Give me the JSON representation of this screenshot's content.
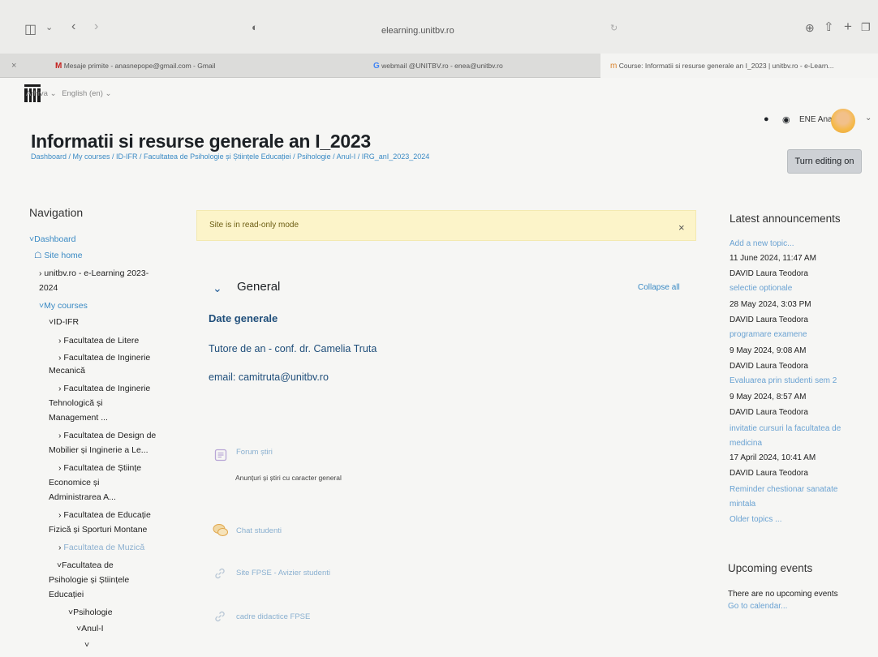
{
  "browser": {
    "address": "elearning.unitbv.ro",
    "tabs": [
      {
        "label": "Mesaje primite - anasnepope@gmail.com - Gmail"
      },
      {
        "label": "webmail @UNITBV.ro - enea@unitbv.ro"
      },
      {
        "label": "Course: Informatii si resurse generale an I_2023 | unitbv.ro - e-Learn..."
      }
    ]
  },
  "topnav": {
    "arhiva": "Arhiva",
    "language": "English (en)",
    "user": "ENE Ana"
  },
  "page": {
    "title": "Informatii si resurse generale an I_2023",
    "breadcrumb": "Dashboard / My courses / ID-IFR / Facultatea de Psihologie și Științele Educației / Psihologie / Anul-I / IRG_anI_2023_2024",
    "turn_editing": "Turn editing on"
  },
  "navigation": {
    "title": "Navigation",
    "items": [
      {
        "label": "Dashboard"
      },
      {
        "label": "Site home"
      },
      {
        "label": "unitbv.ro - e-Learning 2023-"
      },
      {
        "label": "2024"
      },
      {
        "label": "My courses"
      },
      {
        "label": "ID-IFR"
      },
      {
        "label": "Facultatea de Litere"
      },
      {
        "label": "Facultatea de Inginerie"
      },
      {
        "label": "Mecanică"
      },
      {
        "label": "Facultatea de Inginerie"
      },
      {
        "label": "Tehnologică și"
      },
      {
        "label": "Management ..."
      },
      {
        "label": "Facultatea de Design de"
      },
      {
        "label": "Mobilier și Inginerie a Le..."
      },
      {
        "label": "Facultatea de Științe"
      },
      {
        "label": "Economice și"
      },
      {
        "label": "Administrarea A..."
      },
      {
        "label": "Facultatea de Educație"
      },
      {
        "label": "Fizică și Sporturi Montane"
      },
      {
        "label": "Facultatea de Muzică"
      },
      {
        "label": "Facultatea de"
      },
      {
        "label": "Psihologie și Științele"
      },
      {
        "label": "Educației"
      },
      {
        "label": "Psihologie"
      },
      {
        "label": "Anul-I"
      }
    ]
  },
  "main": {
    "alert": "Site is in read-only mode",
    "section_title": "General",
    "collapse_all": "Collapse all",
    "heading": "Date generale",
    "tutor": "Tutore de an - conf. dr. Camelia Truta",
    "email": "email: camitruta@unitbv.ro",
    "activities": [
      {
        "name": "Forum știri",
        "icon": "forum-icon"
      },
      {
        "name": "Chat studenti",
        "icon": "chat-icon"
      },
      {
        "name": "Site FPSE - Avizier studenti",
        "icon": "url-icon"
      },
      {
        "name": "cadre didactice FPSE",
        "icon": "url-icon"
      }
    ],
    "forum_description": "Anunțuri și știri cu caracter general"
  },
  "announcements": {
    "title": "Latest announcements",
    "add_new": "Add a new topic...",
    "items": [
      {
        "date": "11 June 2024, 11:47 AM",
        "author": "DAVID Laura Teodora",
        "topic": "selectie optionale"
      },
      {
        "date": "28 May 2024, 3:03 PM",
        "author": "DAVID Laura Teodora",
        "topic": "programare examene"
      },
      {
        "date": "9 May 2024, 9:08 AM",
        "author": "DAVID Laura Teodora",
        "topic": "Evaluarea prin studenti sem 2"
      },
      {
        "date": "9 May 2024, 8:57 AM",
        "author": "DAVID Laura Teodora",
        "topic": "invitatie cursuri la facultatea de medicina"
      },
      {
        "date": "17 April 2024, 10:41 AM",
        "author": "DAVID Laura Teodora",
        "topic": "Reminder chestionar sanatate mintala"
      }
    ],
    "older": "Older topics ..."
  },
  "events": {
    "title": "Upcoming events",
    "none": "There are no upcoming events",
    "calendar": "Go to calendar..."
  }
}
